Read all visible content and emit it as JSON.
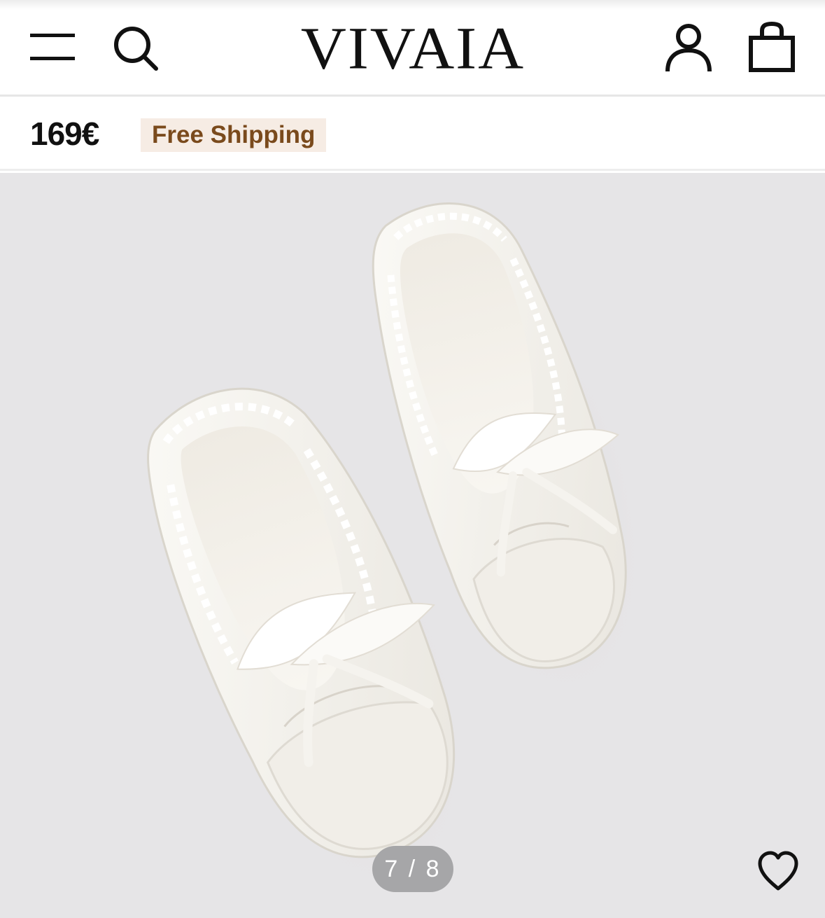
{
  "header": {
    "logo_text": "VIVAIA",
    "icons": {
      "menu": "hamburger-menu-icon",
      "search": "search-icon",
      "account": "user-icon",
      "bag": "shopping-bag-icon"
    }
  },
  "product": {
    "price": "169€",
    "shipping_badge": "Free Shipping",
    "image_alt": "White satin ballet flats with ribbon laces"
  },
  "gallery": {
    "counter": "7 / 8",
    "current": 7,
    "total": 8,
    "wishlist_icon": "heart-icon"
  },
  "colors": {
    "badge_bg": "#f6ece4",
    "badge_text": "#7a4a1c",
    "gallery_bg": "#e6e5e7",
    "counter_bg": "#a6a6a8"
  }
}
